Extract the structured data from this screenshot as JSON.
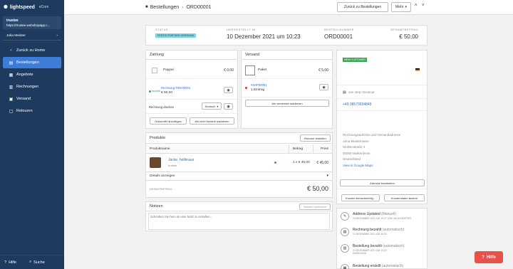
{
  "sidebar": {
    "brand": "lightspeed",
    "brand_suffix": "eCom",
    "shop_name": "trustee",
    "shop_url": "https://trustee.webshopapp.c...",
    "user": "Julia Meister",
    "back": "Zurück zu Home",
    "items": [
      {
        "label": "Bestellungen",
        "icon": "orders-icon"
      },
      {
        "label": "Angebote",
        "icon": "offers-icon"
      },
      {
        "label": "Rechnungen",
        "icon": "invoice-icon"
      },
      {
        "label": "Versand",
        "icon": "shipping-icon"
      },
      {
        "label": "Retouren",
        "icon": "returns-icon"
      }
    ],
    "help": "Hilfe",
    "search": "Suche"
  },
  "topbar": {
    "crumb_parent": "Bestellungen",
    "crumb_current": "ORD00001",
    "back_button": "Zurück zu Bestellungen",
    "more_button": "Mehr"
  },
  "status": {
    "status_label": "STATUS",
    "status_badge": "FERTIG FÜR DEN VERSAND",
    "created_label": "HERGESTELLT IN",
    "created_value": "10 Dezember 2021 um 10:23",
    "number_label": "BESTELLNUMMER",
    "number_value": "ORD00001",
    "total_label": "GESAMTBETRAG",
    "total_value": "€ 50,00"
  },
  "payment": {
    "title": "Zahlung",
    "method": "Paypal",
    "method_amount": "€ 0,00",
    "invoice_link": "Rechnung #INV00001",
    "paid_label": "bezahlt",
    "invoice_amount": "€ 50,00",
    "print_label": "Rechnung drucken",
    "language": "Deutsch",
    "credit_button": "Gutschrift hinzufügen",
    "unpaid_button": "Als nicht bezahlt markieren"
  },
  "shipping": {
    "title": "Versand",
    "method": "Paket",
    "amount": "€ 5,00",
    "shipment_link": "#SHP00001",
    "entries": "1 Eintrag",
    "mark_button": "Als versendet markieren"
  },
  "products": {
    "title": "Produkte",
    "return_button": "Retoure erstellen",
    "col_name": "Produktname",
    "col_amount": "Betrag",
    "col_price": "Preis",
    "item_name": "Jacke, hellbraun",
    "item_brand": "trustee",
    "item_qty": "1 x € 45,00",
    "item_price": "€ 45,00",
    "details": "Details anzeigen",
    "total_label": "GESAMTBETRAG",
    "total_value": "€ 50,00"
  },
  "notes": {
    "title": "Notizen",
    "save_button": "Notizen speichern",
    "placeholder": "Schreiben Sie hier um eine Notiz zu erstellen..."
  },
  "customer": {
    "badge": "NEW CUSTOMER",
    "checkout": "one step checkout",
    "phone": "+49 38573934849",
    "address_heading": "Rechnungsadresse und Versandadresse",
    "address_lines": [
      "Alma Mustermann",
      "Wolkenstraße 4",
      "00000 Wolkenheim",
      "Deutschland"
    ],
    "maps_link": "View in Google Maps",
    "edit_address": "Adresse bearbeiten",
    "notify_button": "Kunden benachrichtig...",
    "edit_customer": "Kundendaten ändern"
  },
  "timeline": [
    {
      "title": "Address Updated",
      "tag": "(Manuell)",
      "sub": "10 DEZEMBER 2021 UM 10:27 VON JULIA MEISTER"
    },
    {
      "title": "Rechnung bezahlt",
      "tag": "(automatisch)",
      "sub": "10 DEZEMBER 2021 UM 10:23"
    },
    {
      "title": "Bestellung bezahlt",
      "tag": "(automatisch)",
      "sub": "10 DEZEMBER 2021 UM 10:23\n8439120208"
    },
    {
      "title": "Bestellung erstellt",
      "tag": "(automatisch)",
      "sub": ""
    }
  ],
  "fab": "Hilfe",
  "colors": {
    "sidebar": "#1e3a5f",
    "active": "#3b7dd8",
    "badge": "#7fd4e0",
    "fab": "#e8504a"
  }
}
